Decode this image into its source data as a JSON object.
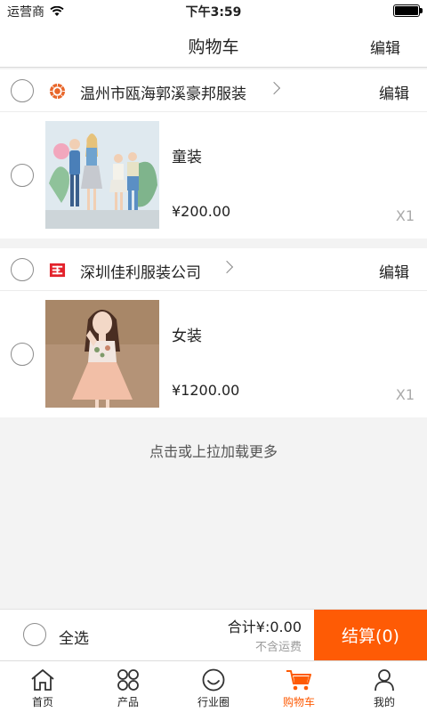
{
  "status_bar": {
    "carrier": "运营商",
    "time": "下午3:59",
    "battery_level": 1.0
  },
  "nav": {
    "title": "购物车",
    "edit_label": "编辑"
  },
  "shops": [
    {
      "name": "温州市瓯海郭溪豪邦服装",
      "edit_label": "编辑",
      "logo_icon": "sun-badge-icon",
      "logo_color": "#e8662a",
      "items": [
        {
          "name": "童装",
          "price": "¥200.00",
          "qty": "X1"
        }
      ]
    },
    {
      "name": "深圳佳利服装公司",
      "edit_label": "编辑",
      "logo_icon": "red-square-logo-icon",
      "logo_color": "#e3222b",
      "items": [
        {
          "name": "女装",
          "price": "¥1200.00",
          "qty": "X1"
        }
      ]
    }
  ],
  "load_more": "点击或上拉加载更多",
  "checkout": {
    "select_all": "全选",
    "total": "合计¥:0.00",
    "shipping_note": "不含运费",
    "button_label": "结算(0)"
  },
  "tabs": [
    {
      "label": "首页",
      "icon": "home-icon"
    },
    {
      "label": "产品",
      "icon": "grid-icon"
    },
    {
      "label": "行业圈",
      "icon": "smile-icon"
    },
    {
      "label": "购物车",
      "icon": "cart-icon",
      "active": true
    },
    {
      "label": "我的",
      "icon": "person-icon"
    }
  ],
  "colors": {
    "accent": "#fe5b05",
    "background": "#f3f3f3"
  }
}
